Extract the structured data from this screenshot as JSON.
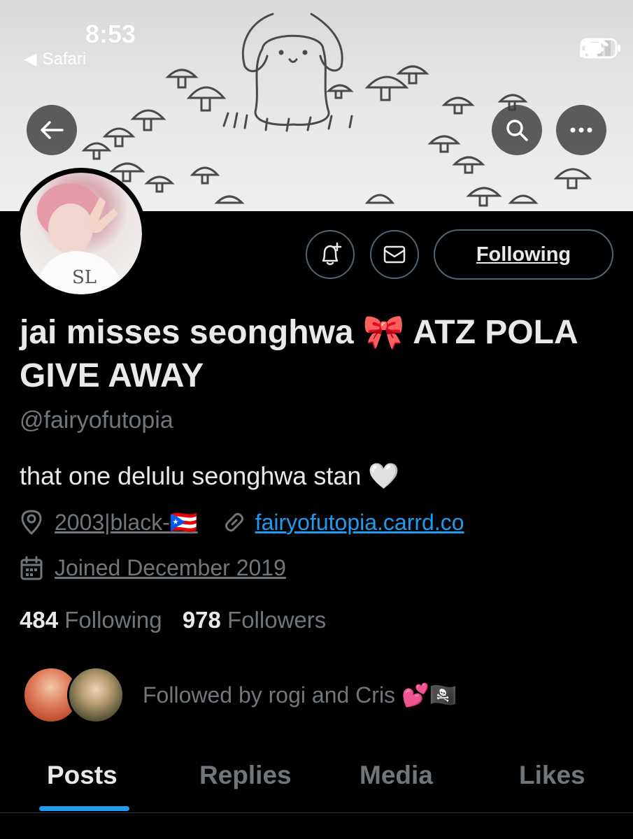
{
  "status_bar": {
    "time": "8:53",
    "back_app": "Safari",
    "icons": [
      "signal-icon",
      "wifi-icon",
      "battery-icon"
    ]
  },
  "header_buttons": {
    "back": "back-arrow-icon",
    "search": "search-icon",
    "more": "more-icon"
  },
  "profile_actions": {
    "notify_icon": "bell-plus-icon",
    "message_icon": "mail-icon",
    "following_label": "Following"
  },
  "profile": {
    "display_name": "jai misses seonghwa 🎀 ATZ POLA GIVE AWAY",
    "handle": "@fairyofutopia",
    "bio": "that one delulu seonghwa stan 🤍",
    "location": "2003|black-🇵🇷",
    "website": "fairyofutopia.carrd.co",
    "joined": "Joined December 2019",
    "following_count": "484",
    "following_label": "Following",
    "followers_count": "978",
    "followers_label": "Followers",
    "followed_by": "Followed by rogi and Cris 💕🏴‍☠️"
  },
  "tabs": [
    "Posts",
    "Replies",
    "Media",
    "Likes"
  ],
  "colors": {
    "accent": "#1d9bf0",
    "background": "#000000",
    "secondary_text": "#71767b",
    "primary_text": "#e7e9ea"
  }
}
